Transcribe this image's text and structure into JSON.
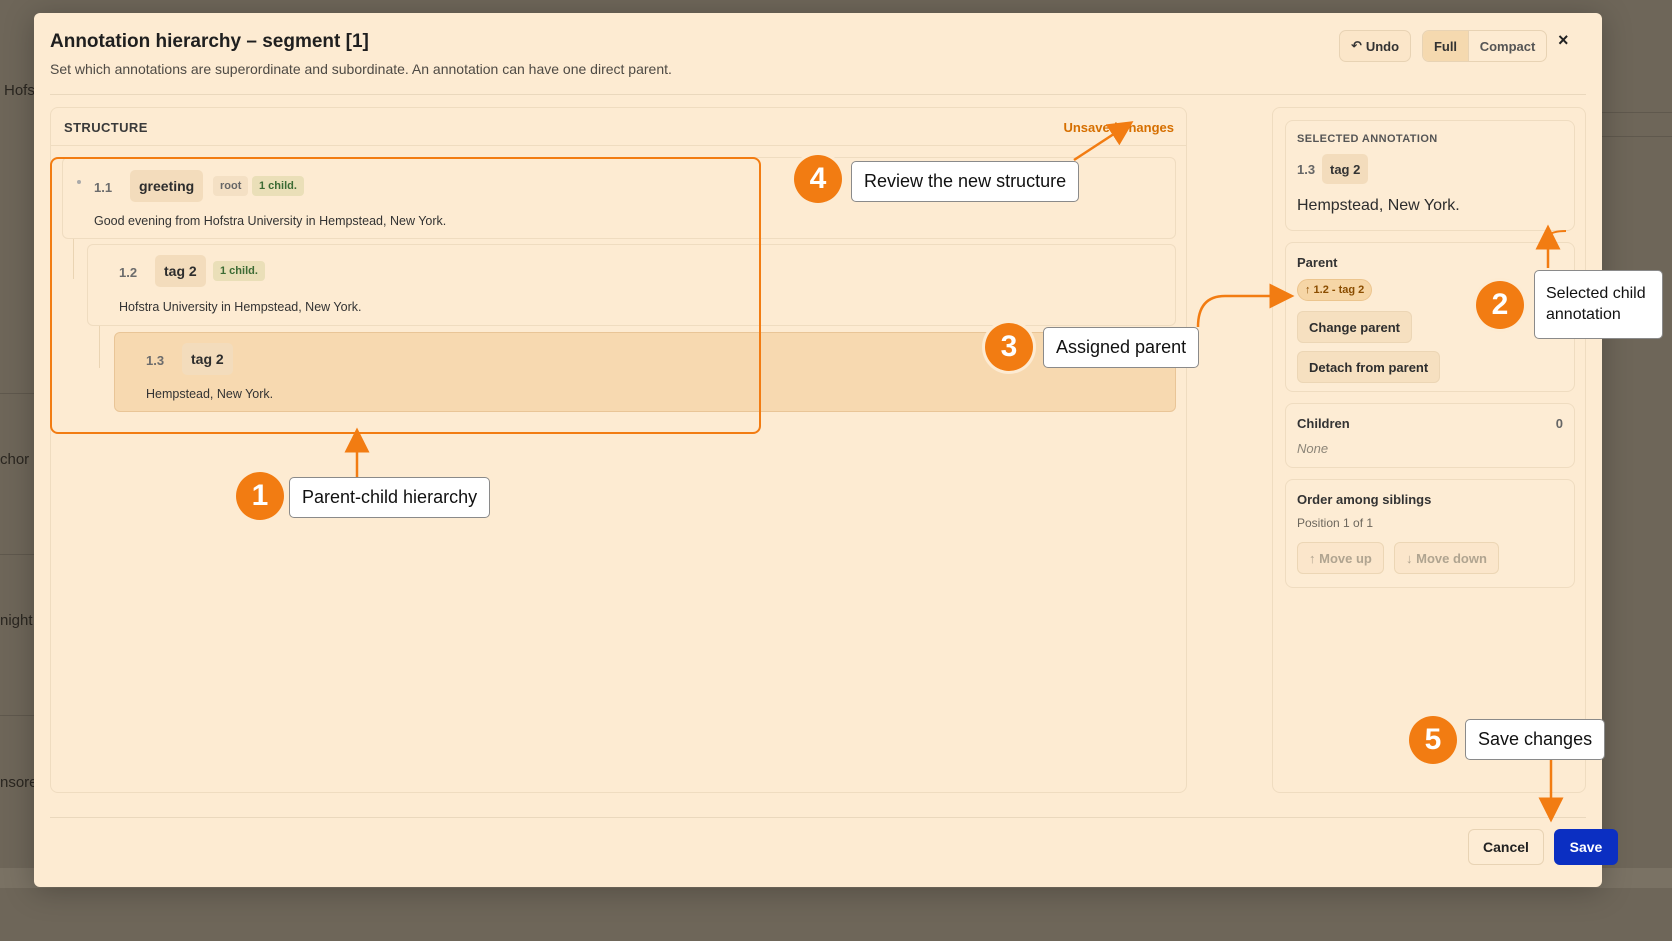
{
  "background": {
    "fragments": [
      "Hofs",
      "chor d",
      "night",
      "nsore"
    ]
  },
  "modal": {
    "title": "Annotation hierarchy – segment [1]",
    "subtitle": "Set which annotations are superordinate and subordinate. An annotation can have one direct parent.",
    "undo_label": "Undo",
    "view_modes": [
      "Full",
      "Compact"
    ],
    "active_view": "Full",
    "close_glyph": "×"
  },
  "structure": {
    "label": "STRUCTURE",
    "status": "Unsaved changes",
    "nodes": [
      {
        "id": "1.1",
        "name": "greeting",
        "tags": [
          "root",
          "1 child."
        ],
        "text": "Good evening from Hofstra University in Hempstead, New York."
      },
      {
        "id": "1.2",
        "name": "tag 2",
        "tags": [
          "1 child."
        ],
        "text": "Hofstra University in Hempstead, New York."
      },
      {
        "id": "1.3",
        "name": "tag 2",
        "tags": [],
        "text": "Hempstead, New York."
      }
    ]
  },
  "selected": {
    "label": "SELECTED ANNOTATION",
    "id": "1.3",
    "name": "tag 2",
    "text": "Hempstead, New York.",
    "parent_label": "Parent",
    "parent_value": "↑ 1.2 - tag 2",
    "change_parent": "Change parent",
    "detach_parent": "Detach from parent",
    "children_label": "Children",
    "children_count": "0",
    "children_none": "None",
    "order_label": "Order among siblings",
    "order_position": "Position 1 of 1",
    "move_up": "↑ Move up",
    "move_down": "↓ Move down"
  },
  "footer": {
    "cancel": "Cancel",
    "save": "Save"
  },
  "annotations": [
    {
      "number": "1",
      "text": "Parent-child hierarchy"
    },
    {
      "number": "2",
      "text": "Selected child annotation"
    },
    {
      "number": "3",
      "text": "Assigned parent"
    },
    {
      "number": "4",
      "text": "Review the new structure"
    },
    {
      "number": "5",
      "text": "Save changes"
    }
  ],
  "colors": {
    "accent": "#f27c12",
    "save_button": "#0b2fc2",
    "modal_bg": "#fdebd2",
    "unsaved": "#d66f00"
  }
}
